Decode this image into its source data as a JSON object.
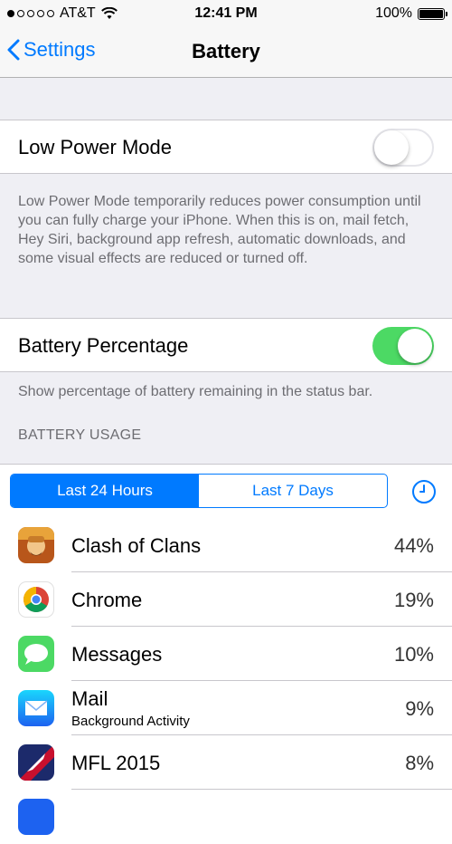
{
  "status": {
    "carrier": "AT&T",
    "time": "12:41 PM",
    "battery": "100%"
  },
  "nav": {
    "back_label": "Settings",
    "title": "Battery"
  },
  "low_power": {
    "label": "Low Power Mode",
    "enabled": false,
    "description": "Low Power Mode temporarily reduces power consumption until you can fully charge your iPhone. When this is on, mail fetch, Hey Siri, background app refresh, automatic downloads, and some visual effects are reduced or turned off."
  },
  "battery_percentage": {
    "label": "Battery Percentage",
    "enabled": true,
    "description": "Show percentage of battery remaining in the status bar."
  },
  "usage": {
    "header": "BATTERY USAGE",
    "segments": [
      "Last 24 Hours",
      "Last 7 Days"
    ],
    "selected_segment": "Last 24 Hours",
    "apps": [
      {
        "name": "Clash of Clans",
        "subtitle": "",
        "percent": "44%",
        "icon": "clash-of-clans-icon"
      },
      {
        "name": "Chrome",
        "subtitle": "",
        "percent": "19%",
        "icon": "chrome-icon"
      },
      {
        "name": "Messages",
        "subtitle": "",
        "percent": "10%",
        "icon": "messages-icon"
      },
      {
        "name": "Mail",
        "subtitle": "Background Activity",
        "percent": "9%",
        "icon": "mail-icon"
      },
      {
        "name": "MFL 2015",
        "subtitle": "",
        "percent": "8%",
        "icon": "mfl-2015-icon"
      }
    ]
  },
  "colors": {
    "accent": "#007aff",
    "switch_on": "#4cd964",
    "background": "#efeff4"
  }
}
